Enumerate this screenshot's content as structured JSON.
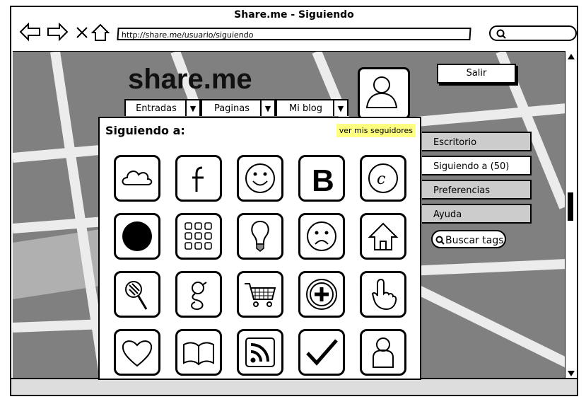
{
  "window": {
    "title": "Share.me - Siguiendo"
  },
  "browser": {
    "url": "http://share.me/usuario/siguiendo",
    "search_value": ""
  },
  "site": {
    "logo": "share.me",
    "logout_label": "Salir"
  },
  "tabs": [
    {
      "label": "Entradas"
    },
    {
      "label": "Paginas"
    },
    {
      "label": "Mi blog"
    }
  ],
  "panel": {
    "title": "Siguiendo a:",
    "followers_link": "ver mis seguidores",
    "icons": [
      "cloud-icon",
      "facebook-icon",
      "smiley-icon",
      "blogger-icon",
      "copyright-icon",
      "black-circle-icon",
      "grid-apps-icon",
      "lightbulb-icon",
      "sad-face-icon",
      "home-icon",
      "lollipop-icon",
      "google-icon",
      "cart-icon",
      "add-icon",
      "hand-pointer-icon",
      "heart-icon",
      "book-icon",
      "rss-icon",
      "check-icon",
      "user-icon"
    ]
  },
  "sidebar": {
    "items": [
      {
        "label": "Escritorio"
      },
      {
        "label": "Siguiendo a (50)"
      },
      {
        "label": "Preferencias"
      },
      {
        "label": "Ayuda"
      }
    ],
    "tag_search_label": "Buscar tags"
  }
}
